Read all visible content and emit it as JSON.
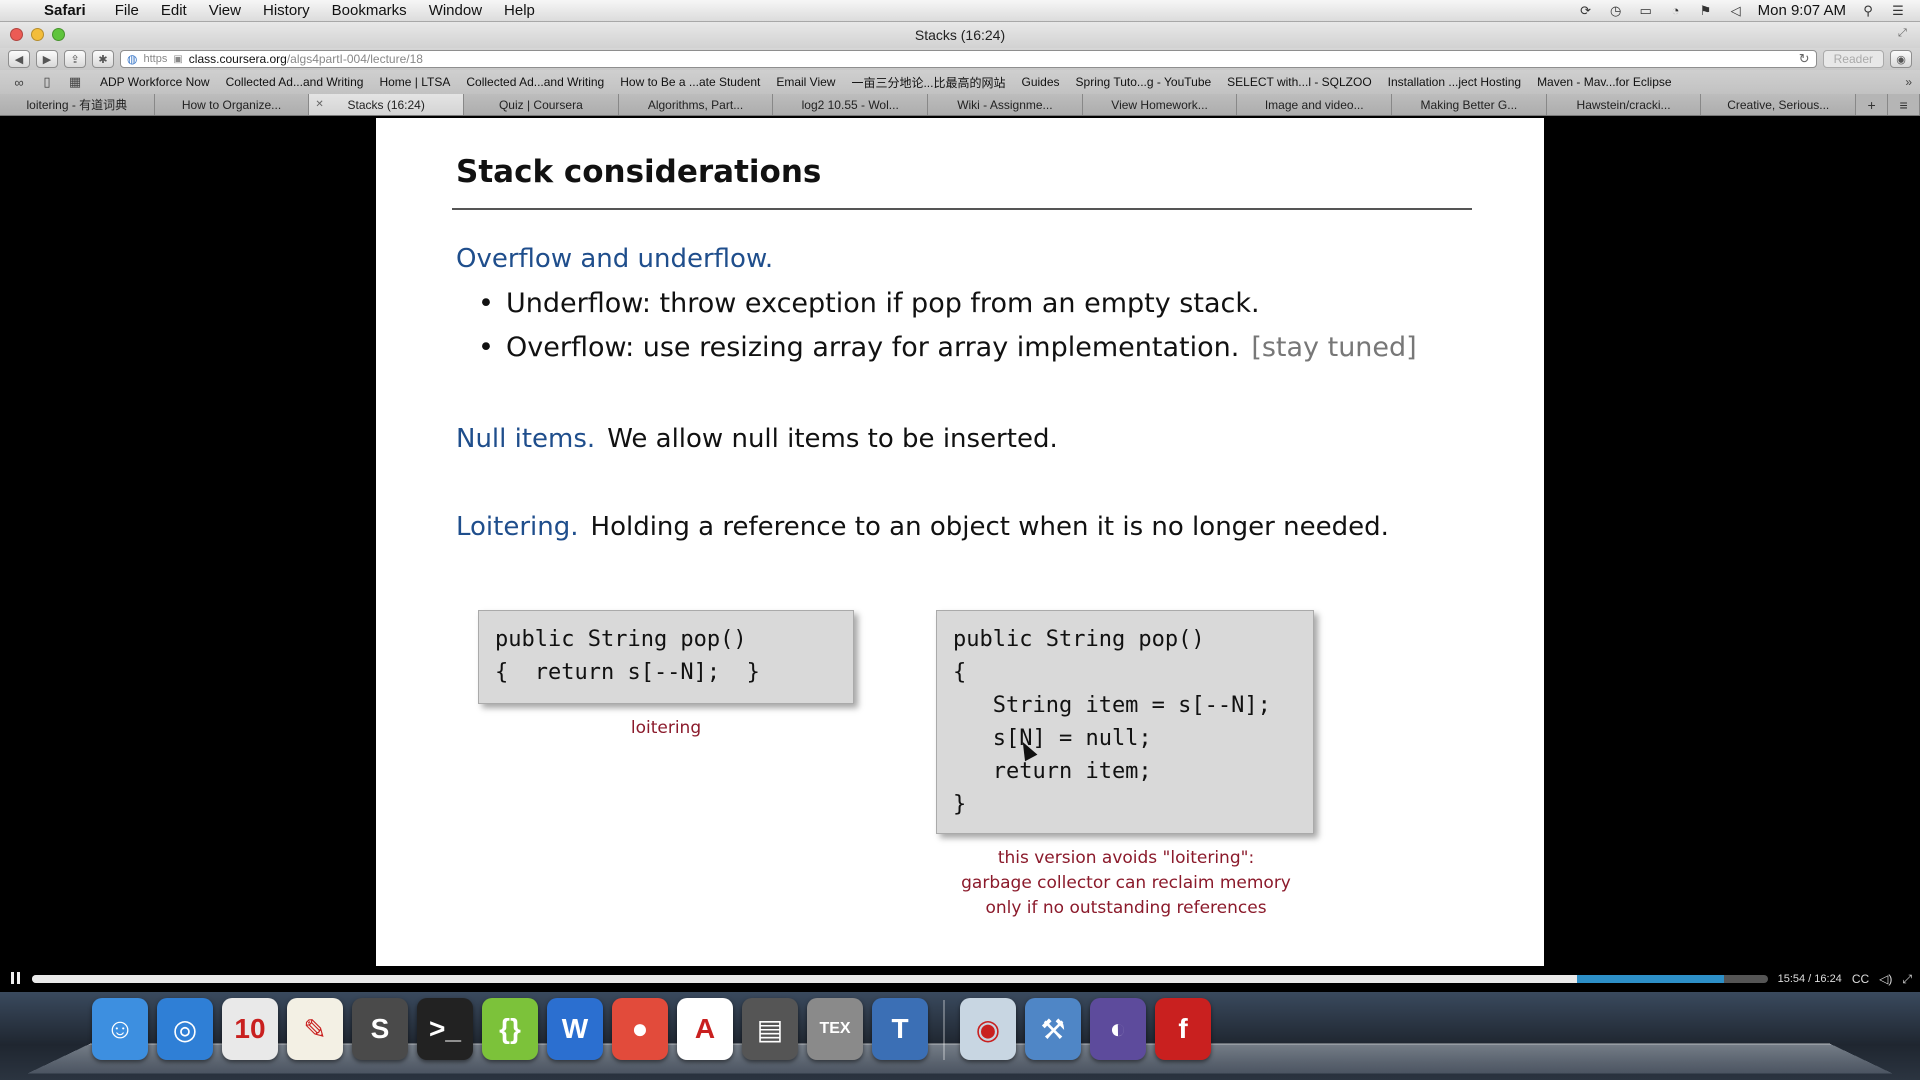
{
  "menubar": {
    "app_name": "Safari",
    "menus": [
      "File",
      "Edit",
      "View",
      "History",
      "Bookmarks",
      "Window",
      "Help"
    ],
    "clock": "Mon 9:07 AM"
  },
  "window": {
    "title": "Stacks (16:24)"
  },
  "toolbar": {
    "url_scheme": "https",
    "url_host": "class.coursera.org",
    "url_path": "/algs4partI-004/lecture/18",
    "reader_label": "Reader"
  },
  "bookmarks": [
    "ADP Workforce Now",
    "Collected Ad...and Writing",
    "Home | LTSA",
    "Collected Ad...and Writing",
    "How to Be a ...ate Student",
    "Email View",
    "一亩三分地论...比最高的网站",
    "Guides",
    "Spring Tuto...g - YouTube",
    "SELECT with...l - SQLZOO",
    "Installation ...ject Hosting",
    "Maven - Mav...for Eclipse"
  ],
  "tabs": [
    {
      "label": "loitering - 有道词典",
      "active": false
    },
    {
      "label": "How to Organize...",
      "active": false
    },
    {
      "label": "Stacks (16:24)",
      "active": true
    },
    {
      "label": "Quiz | Coursera",
      "active": false
    },
    {
      "label": "Algorithms, Part...",
      "active": false
    },
    {
      "label": "log2 10.55 - Wol...",
      "active": false
    },
    {
      "label": "Wiki - Assignme...",
      "active": false
    },
    {
      "label": "View Homework...",
      "active": false
    },
    {
      "label": "Image and video...",
      "active": false
    },
    {
      "label": "Making Better G...",
      "active": false
    },
    {
      "label": "Hawstein/cracki...",
      "active": false
    },
    {
      "label": "Creative, Serious...",
      "active": false
    }
  ],
  "slide": {
    "title": "Stack considerations",
    "overflow_heading": "Overflow and underflow.",
    "bullet1": "Underflow:  throw exception if pop from an empty stack.",
    "bullet2": "Overflow:  use resizing array for array implementation.",
    "bullet2_muted": "[stay tuned]",
    "null_heading": "Null items.",
    "null_body": "We allow null items to be inserted.",
    "loiter_heading": "Loitering.",
    "loiter_body": "Holding a reference to an object when it is no longer needed.",
    "code_left": "public String pop()\n{  return s[--N];  }",
    "caption_left": "loitering",
    "code_right": "public String pop()\n{\n   String item = s[--N];\n   s[N] = null;\n   return item;\n}",
    "caption_right_1": "this version avoids \"loitering\":",
    "caption_right_2": "garbage collector can reclaim memory",
    "caption_right_3": "only if no outstanding references"
  },
  "player": {
    "time": "15:54 / 16:24",
    "played_fraction": 0.8902,
    "buffered_fraction": 0.975,
    "cc_label": "CC"
  },
  "dock": {
    "items": [
      {
        "name": "finder",
        "glyph": "☺",
        "color": "#3d8fe0"
      },
      {
        "name": "safari",
        "glyph": "◎",
        "color": "#2f7fd6"
      },
      {
        "name": "calendar",
        "glyph": "10",
        "color": "#e9e9e9"
      },
      {
        "name": "textedit",
        "glyph": "✎",
        "color": "#f3f0e4"
      },
      {
        "name": "sublime",
        "glyph": "S",
        "color": "#4a4a4a"
      },
      {
        "name": "terminal",
        "glyph": ">_",
        "color": "#222222"
      },
      {
        "name": "brackets",
        "glyph": "{}",
        "color": "#7cc23a"
      },
      {
        "name": "word",
        "glyph": "W",
        "color": "#2b6fd0"
      },
      {
        "name": "chrome",
        "glyph": "●",
        "color": "#e24b3b"
      },
      {
        "name": "acrobat",
        "glyph": "A",
        "color": "#ffffff"
      },
      {
        "name": "console",
        "glyph": "▤",
        "color": "#555555"
      },
      {
        "name": "texshop",
        "glyph": "TEX",
        "color": "#8a8a8a"
      },
      {
        "name": "textwrangler",
        "glyph": "T",
        "color": "#3b6fb5"
      },
      {
        "name": "preview",
        "glyph": "◉",
        "color": "#c8d6e2"
      },
      {
        "name": "xcode",
        "glyph": "⚒",
        "color": "#4f86c6"
      },
      {
        "name": "eclipse",
        "glyph": "◐",
        "color": "#5d4b9c"
      },
      {
        "name": "flash",
        "glyph": "f",
        "color": "#c9201f"
      }
    ]
  }
}
